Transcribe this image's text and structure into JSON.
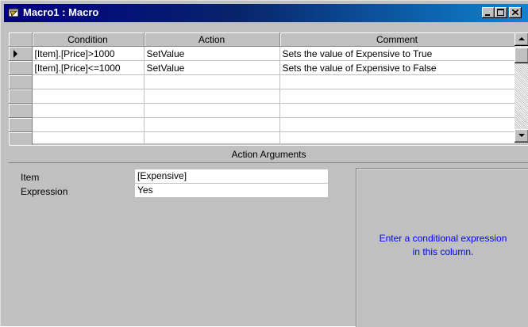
{
  "window": {
    "title": "Macro1 : Macro",
    "icon": "macro-icon",
    "controls": [
      "minimize-icon",
      "maximize-icon",
      "close-icon"
    ]
  },
  "grid": {
    "columns": [
      "Condition",
      "Action",
      "Comment"
    ],
    "rows": [
      {
        "condition": "[Item].[Price]>1000",
        "action": "SetValue",
        "comment": "Sets the value of Expensive to True",
        "selected": true
      },
      {
        "condition": "[Item].[Price]<=1000",
        "action": "SetValue",
        "comment": "Sets the value of Expensive to False"
      },
      {
        "condition": "",
        "action": "",
        "comment": ""
      },
      {
        "condition": "",
        "action": "",
        "comment": ""
      },
      {
        "condition": "",
        "action": "",
        "comment": ""
      },
      {
        "condition": "",
        "action": "",
        "comment": ""
      },
      {
        "condition": "",
        "action": "",
        "comment": ""
      }
    ]
  },
  "action_arguments": {
    "header": "Action Arguments",
    "fields": [
      {
        "label": "Item",
        "value": "[Expensive]"
      },
      {
        "label": "Expression",
        "value": "Yes"
      }
    ],
    "help_text": "Enter a conditional expression\nin this column."
  },
  "colors": {
    "title_bar_start": "#000080",
    "title_bar_end": "#1084d0",
    "face": "#c0c0c0",
    "help_text": "#0000ff"
  }
}
